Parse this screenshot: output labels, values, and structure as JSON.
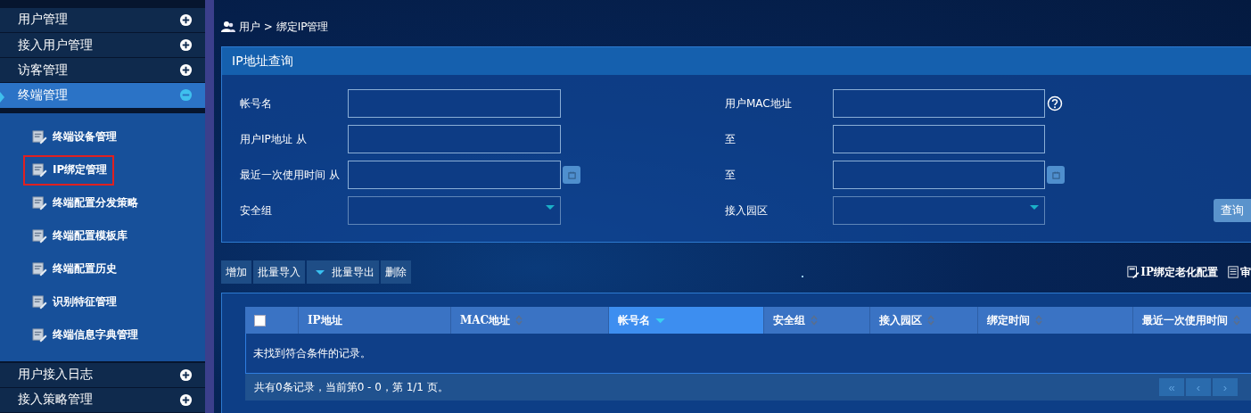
{
  "sidebar": {
    "items": [
      {
        "label": "用户管理",
        "expanded": false
      },
      {
        "label": "接入用户管理",
        "expanded": false
      },
      {
        "label": "访客管理",
        "expanded": false
      },
      {
        "label": "终端管理",
        "expanded": true,
        "children": [
          {
            "label": "终端设备管理",
            "selected": false
          },
          {
            "label": "IP绑定管理",
            "selected": true
          },
          {
            "label": "终端配置分发策略",
            "selected": false
          },
          {
            "label": "终端配置模板库",
            "selected": false
          },
          {
            "label": "终端配置历史",
            "selected": false
          },
          {
            "label": "识别特征管理",
            "selected": false
          },
          {
            "label": "终端信息字典管理",
            "selected": false
          }
        ]
      },
      {
        "label": "用户接入日志",
        "expanded": false
      },
      {
        "label": "接入策略管理",
        "expanded": false
      }
    ]
  },
  "breadcrumb": "用户 > 绑定IP管理",
  "query_panel": {
    "title": "IP地址查询",
    "fields": [
      {
        "label": "帐号名",
        "kind": "text",
        "help": false
      },
      {
        "label": "用户MAC地址",
        "kind": "text",
        "help": true
      },
      {
        "label": "用户IP地址 从",
        "kind": "text",
        "help": false
      },
      {
        "label": "至",
        "kind": "text",
        "help": false
      },
      {
        "label": "最近一次使用时间 从",
        "kind": "date",
        "help": false
      },
      {
        "label": "至",
        "kind": "date",
        "help": false
      },
      {
        "label": "安全组",
        "kind": "select",
        "help": false
      },
      {
        "label": "接入园区",
        "kind": "select",
        "help": false
      }
    ],
    "query_button": "查询"
  },
  "toolbar": [
    {
      "label": "增加",
      "dropdown": false
    },
    {
      "label": "批量导入",
      "dropdown": false
    },
    {
      "label": "批量导出",
      "dropdown": true
    },
    {
      "label": "删除",
      "dropdown": false
    }
  ],
  "links": [
    "IP绑定老化配置",
    "审"
  ],
  "table": {
    "columns": [
      {
        "kind": "checkbox",
        "checked": false
      },
      {
        "kind": "text",
        "label": "IP地址",
        "sortable": false,
        "sorted_descending": false,
        "selected": false
      },
      {
        "kind": "text",
        "label": "MAC地址",
        "sortable": true,
        "sorted_descending": false,
        "selected": false
      },
      {
        "kind": "text",
        "label": "帐号名",
        "sortable": true,
        "sorted_descending": true,
        "selected": true
      },
      {
        "kind": "text",
        "label": "安全组",
        "sortable": true,
        "sorted_descending": false,
        "selected": false
      },
      {
        "kind": "text",
        "label": "接入园区",
        "sortable": true,
        "sorted_descending": false,
        "selected": false
      },
      {
        "kind": "text",
        "label": "绑定时间",
        "sortable": true,
        "sorted_descending": false,
        "selected": false
      },
      {
        "kind": "text",
        "label": "最近一次使用时间",
        "sortable": true,
        "sorted_descending": false,
        "selected": false
      }
    ],
    "empty_message": "未找到符合条件的记录。",
    "footer": "共有0条记录，当前第0 - 0，第 1/1 页。",
    "pager": [
      "«",
      "‹",
      "›"
    ]
  }
}
